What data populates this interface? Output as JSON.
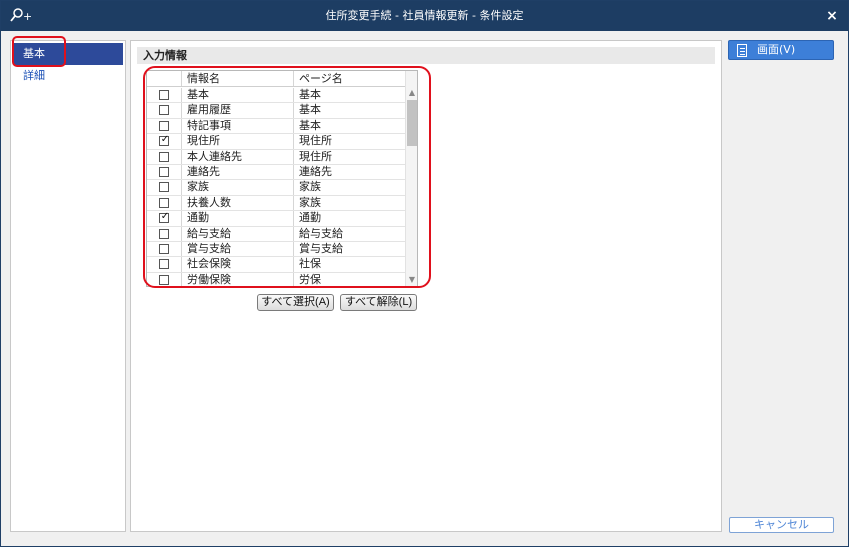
{
  "window": {
    "title": "住所変更手続 - 社員情報更新 - 条件設定",
    "search_glyph": "+",
    "close_label": "×"
  },
  "sidebar": {
    "items": [
      {
        "label": "基本",
        "active": true
      },
      {
        "label": "詳細",
        "active": false
      }
    ]
  },
  "main": {
    "section_title": "入力情報",
    "columns": {
      "name": "情報名",
      "page": "ページ名"
    },
    "rows": [
      {
        "name": "基本",
        "page": "基本",
        "checked": false
      },
      {
        "name": "雇用履歴",
        "page": "基本",
        "checked": false
      },
      {
        "name": "特記事項",
        "page": "基本",
        "checked": false
      },
      {
        "name": "現住所",
        "page": "現住所",
        "checked": true
      },
      {
        "name": "本人連絡先",
        "page": "現住所",
        "checked": false
      },
      {
        "name": "連絡先",
        "page": "連絡先",
        "checked": false
      },
      {
        "name": "家族",
        "page": "家族",
        "checked": false
      },
      {
        "name": "扶養人数",
        "page": "家族",
        "checked": false
      },
      {
        "name": "通勤",
        "page": "通勤",
        "checked": true
      },
      {
        "name": "給与支給",
        "page": "給与支給",
        "checked": false
      },
      {
        "name": "賞与支給",
        "page": "賞与支給",
        "checked": false
      },
      {
        "name": "社会保険",
        "page": "社保",
        "checked": false
      },
      {
        "name": "労働保険",
        "page": "労保",
        "checked": false
      }
    ],
    "select_all_label": "すべて選択(A)",
    "deselect_all_label": "すべて解除(L)"
  },
  "right_panel": {
    "screen_label": "画面(V)",
    "cancel_label": "キャンセル"
  },
  "colors": {
    "titlebar": "#1d3d63",
    "sidebar_active": "#2d4a9a",
    "accent_button": "#3d7fd8",
    "highlight": "#e0101c"
  }
}
